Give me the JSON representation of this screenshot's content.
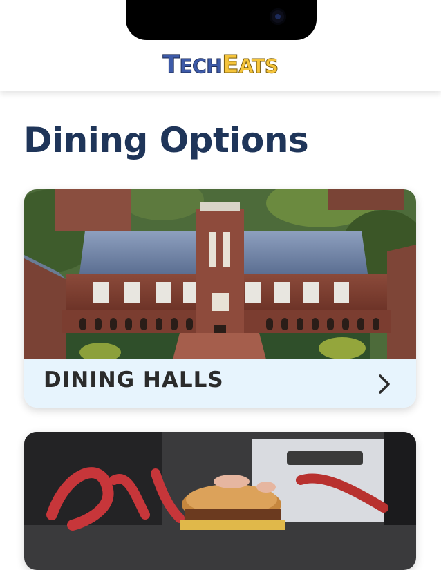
{
  "app": {
    "logo": {
      "tech_big": "T",
      "tech_small": "ECH",
      "eats_big": "E",
      "eats_small": "ATS"
    }
  },
  "page": {
    "title": "Dining Options"
  },
  "cards": [
    {
      "label": "DINING HALLS",
      "icon": "chevron-right-icon"
    },
    {
      "label": "",
      "icon": "chevron-right-icon"
    }
  ],
  "colors": {
    "title": "#1f3559",
    "card_footer": "#e7f4fd",
    "logo_blue": "#3d5aa8",
    "logo_gold": "#f5c43b"
  }
}
